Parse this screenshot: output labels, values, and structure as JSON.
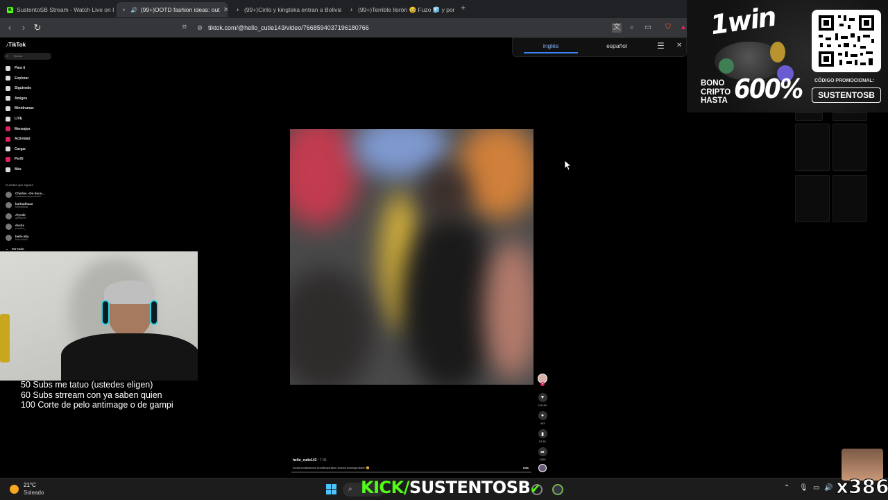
{
  "browser": {
    "tabs": [
      {
        "label": "SustentoSB Stream - Watch Live on K",
        "favicon_color": "#53fc18",
        "active": false
      },
      {
        "label": "(99+)OOTD fashion ideas: out",
        "favicon_color": "#ffffff",
        "active": true
      },
      {
        "label": "(99+)Cirilo y kingteka entran a Bolivia",
        "favicon_color": "#ffffff",
        "active": false
      },
      {
        "label": "(99+)Terrible llorón 🥹 Fuzo 🧊 y por",
        "favicon_color": "#ffffff",
        "active": false
      }
    ],
    "new_tab_label": "+",
    "url": "tiktok.com/@hello_cutie143/video/7668594037196180766"
  },
  "translate": {
    "option_1": "inglés",
    "option_2": "español"
  },
  "tiktok": {
    "logo": "TikTok",
    "search_placeholder": "Buscar",
    "nav": [
      "Para ti",
      "Explorar",
      "Siguiendo",
      "Amigos",
      "Minidramas",
      "LIVE",
      "Mensajes",
      "Actividad",
      "Cargar",
      "Perfil",
      "Más"
    ],
    "following_header": "Cuentas que sigues",
    "following": [
      {
        "name": "Charles ~Do tinco...",
        "handle": "charleselectocerodoblel"
      },
      {
        "name": "barbaditaaa",
        "handle": "barbaditaaa"
      },
      {
        "name": "Alyvde",
        "handle": "alyvde099"
      },
      {
        "name": "ducks",
        "handle": "pequitos_"
      },
      {
        "name": "bello ella",
        "handle": "bello.ella04"
      }
    ],
    "see_all": "Ver todo",
    "video": {
      "username": "hello_cutie143",
      "date": "7-31",
      "caption": "#ootd #ootdfashion #ootdinspiration #views #viewsproblem 😊",
      "more": "más"
    },
    "actions": [
      {
        "name": "like",
        "count": "115.4K"
      },
      {
        "name": "comment",
        "count": "443"
      },
      {
        "name": "save",
        "count": "13.1K"
      },
      {
        "name": "share",
        "count": "1029"
      }
    ]
  },
  "stream": {
    "goals": [
      "50 Subs me tatuo (ustedes eligen)",
      "60 Subs strream con ya saben quien",
      "100 Corte de pelo antimage o de gampi"
    ],
    "ad": {
      "brand": "1win",
      "bonus_line_1": "BONO",
      "bonus_line_2": "CRIPTO",
      "bonus_line_3": "HASTA",
      "bonus_value": "600%",
      "promo_label": "CÓDIGO PROMOCIONAL:",
      "promo_code": "SUSTENTOSB"
    },
    "banner_prefix": "KICK/",
    "banner_name": "SUSTENTOSB",
    "counter": "x386"
  },
  "taskbar": {
    "temperature": "21°C",
    "weather": "Soleado"
  },
  "colors": {
    "kick_green": "#53fc18",
    "tiktok_red": "#e0245e",
    "translate_blue": "#3b82f6"
  }
}
